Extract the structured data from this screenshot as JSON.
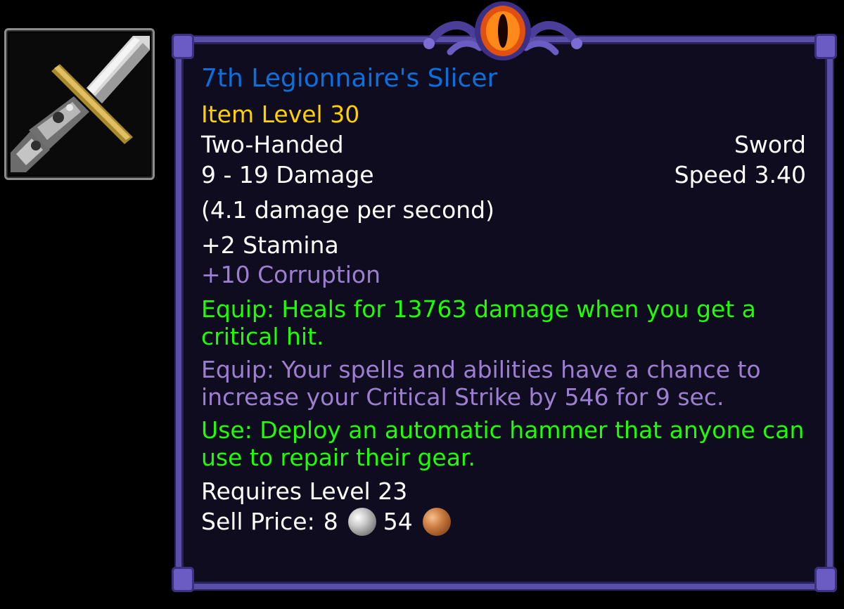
{
  "item": {
    "name": "7th Legionnaire's Slicer",
    "item_level": "Item Level 30",
    "handedness": "Two-Handed",
    "weapon_type": "Sword",
    "damage": "9 - 19 Damage",
    "speed": "Speed 3.40",
    "dps": "(4.1 damage per second)",
    "stat": "+2 Stamina",
    "corruption": "+10 Corruption",
    "equip_effect_1": "Equip: Heals for 13763 damage when you get a critical hit.",
    "equip_effect_2": "Equip: Your spells and abilities have a chance to increase your Critical Strike by 546 for 9 sec.",
    "use_effect": "Use: Deploy an automatic hammer that anyone can use to repair their gear.",
    "requires_level": "Requires Level 23",
    "sell_price_label": "Sell Price:",
    "sell_price_silver": "8",
    "sell_price_copper": "54",
    "icon": "two-handed-sword-icon"
  },
  "colors": {
    "title": "#0a70dd",
    "item_level": "#ffd100",
    "normal_text": "#ffffff",
    "corruption": "#9d7fd1",
    "equip_green": "#1eff00",
    "frame_border": "#5a4fa8",
    "background": "#0e0c1e"
  }
}
